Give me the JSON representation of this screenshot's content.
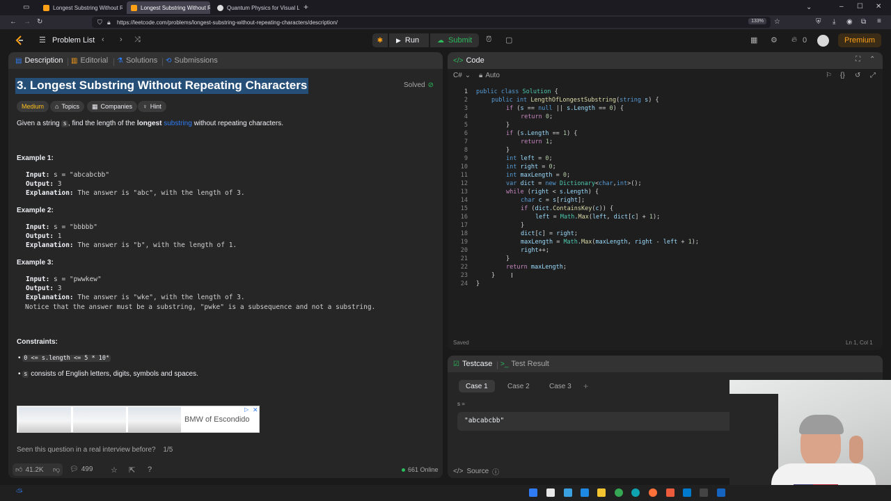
{
  "browser": {
    "tabs": [
      {
        "title": "Longest Substring Without Rep",
        "active": false
      },
      {
        "title": "Longest Substring Without Rep",
        "active": true
      },
      {
        "title": "Quantum Physics for Visual Lea",
        "active": false
      }
    ],
    "url": "https://leetcode.com/problems/longest-substring-without-repeating-characters/description/",
    "zoom": "133%"
  },
  "nav": {
    "problem_list": "Problem List",
    "run": "Run",
    "submit": "Submit",
    "streak": "0",
    "premium": "Premium"
  },
  "left_tabs": [
    "Description",
    "Editorial",
    "Solutions",
    "Submissions"
  ],
  "problem": {
    "title": "3. Longest Substring Without Repeating Characters",
    "status": "Solved",
    "difficulty": "Medium",
    "tags": [
      "Topics",
      "Companies",
      "Hint"
    ],
    "desc_pre": "Given a string ",
    "desc_var": "s",
    "desc_mid": ", find the length of the ",
    "desc_bold": "longest",
    "desc_link": "substring",
    "desc_post": " without repeating characters.",
    "examples": [
      {
        "head": "Example 1:",
        "input": " s = \"abcabcbb\"",
        "output": " 3",
        "explanation": " The answer is \"abc\", with the length of 3."
      },
      {
        "head": "Example 2:",
        "input": " s = \"bbbbb\"",
        "output": " 1",
        "explanation": " The answer is \"b\", with the length of 1."
      },
      {
        "head": "Example 3:",
        "input": " s = \"pwwkew\"",
        "output": " 3",
        "explanation": " The answer is \"wke\", with the length of 3.",
        "note": "Notice that the answer must be a substring, \"pwke\" is a subsequence and not a substring."
      }
    ],
    "labels": {
      "input": "Input:",
      "output": "Output:",
      "explanation": "Explanation:"
    },
    "constraints_head": "Constraints:",
    "constraint1": "0 <= s.length <= 5 * 10⁴",
    "constraint2_var": "s",
    "constraint2": " consists of English letters, digits, symbols and spaces.",
    "ad_text": "BMW of Escondido",
    "interview_q": "Seen this question in a real interview before?",
    "interview_page": "1/5",
    "likes": "41.2K",
    "comments": "499",
    "online": "661 Online"
  },
  "code": {
    "panel_title": "Code",
    "language": "C#",
    "mode": "Auto",
    "saved": "Saved",
    "cursor": "Ln 1, Col 1",
    "line_numbers": [
      "1",
      "2",
      "3",
      "4",
      "5",
      "6",
      "7",
      "8",
      "9",
      "10",
      "11",
      "12",
      "13",
      "14",
      "15",
      "16",
      "17",
      "18",
      "19",
      "20",
      "21",
      "22",
      "23",
      "24"
    ]
  },
  "testcase": {
    "tab": "Testcase",
    "result_tab": "Test Result",
    "cases": [
      "Case 1",
      "Case 2",
      "Case 3"
    ],
    "var_label": "s =",
    "value": "\"abcabcbb\"",
    "source": "Source"
  },
  "colors": {
    "accent_orange": "#ffa116",
    "easy_green": "#2cbb5d",
    "medium_yellow": "#ffc01e",
    "link_blue": "#2f7cf6"
  }
}
